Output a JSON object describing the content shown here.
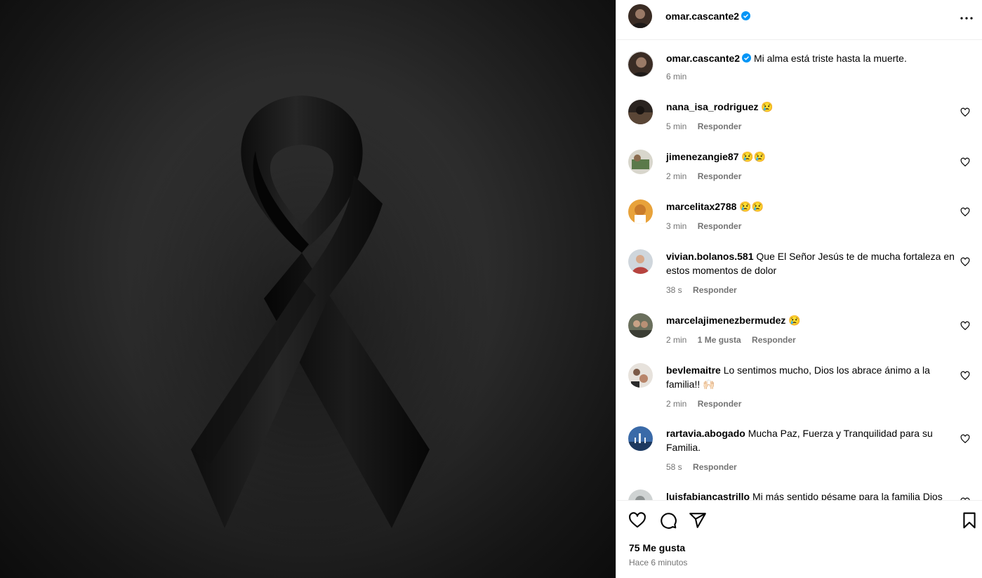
{
  "post": {
    "username": "omar.cascante2",
    "caption": "Mi alma está triste hasta la muerte.",
    "caption_time": "6 min",
    "likes_label": "75 Me gusta",
    "posted_ago": "Hace 6 minutos"
  },
  "colors": {
    "verified": "#0095f6",
    "meta_text": "#737373",
    "ribbon": "#0a0a0a"
  },
  "icons": {
    "more": "more-options-icon",
    "like": "heart-icon",
    "comment": "comment-icon",
    "share": "share-icon",
    "save": "bookmark-icon"
  },
  "comments": [
    {
      "user": "nana_isa_rodriguez",
      "text": "😢",
      "time": "5 min",
      "likes": "",
      "reply": "Responder"
    },
    {
      "user": "jimenezangie87",
      "text": "😢😢",
      "time": "2 min",
      "likes": "",
      "reply": "Responder"
    },
    {
      "user": "marcelitax2788",
      "text": "😢😢",
      "time": "3 min",
      "likes": "",
      "reply": "Responder"
    },
    {
      "user": "vivian.bolanos.581",
      "text": "Que El Señor Jesús te de mucha fortaleza en estos momentos de dolor",
      "time": "38 s",
      "likes": "",
      "reply": "Responder"
    },
    {
      "user": "marcelajimenezbermudez",
      "text": "😢",
      "time": "2 min",
      "likes": "1 Me gusta",
      "reply": "Responder"
    },
    {
      "user": "bevlemaitre",
      "text": "Lo sentimos mucho, Dios los abrace ánimo a la familia!! 🙌🏻",
      "time": "2 min",
      "likes": "",
      "reply": "Responder"
    },
    {
      "user": "rartavia.abogado",
      "text": "Mucha Paz, Fuerza y Tranquilidad para su Familia.",
      "time": "58 s",
      "likes": "",
      "reply": "Responder"
    },
    {
      "user": "luisfabiancastrillo",
      "text": "Mi más sentido pésame para la familia Dios",
      "time": "",
      "likes": "",
      "reply": ""
    }
  ]
}
